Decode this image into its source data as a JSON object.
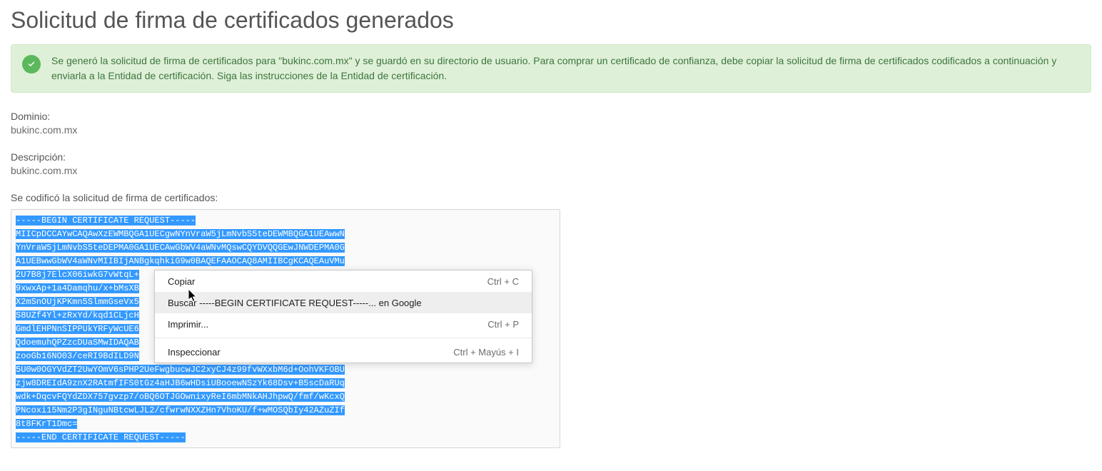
{
  "page": {
    "title": "Solicitud de firma de certificados generados"
  },
  "alert": {
    "message": "Se generó la solicitud de firma de certificados para \"bukinc.com.mx\" y se guardó en su directorio de usuario. Para comprar un certificado de confianza, debe copiar la solicitud de firma de certificados codificados a continuación y enviarla a la Entidad de certificación. Siga las instrucciones de la Entidad de certificación."
  },
  "fields": {
    "domain_label": "Dominio:",
    "domain_value": "bukinc.com.mx",
    "description_label": "Descripción:",
    "description_value": "bukinc.com.mx",
    "csr_label": "Se codificó la solicitud de firma de certificados:"
  },
  "csr": "-----BEGIN CERTIFICATE REQUEST-----\nMIICpDCCAYwCAQAwXzEWMBQGA1UECgwNYnVraW5jLmNvbS5teDEWMBQGA1UEAwwN\nYnVraW5jLmNvbS5teDEPMA0GA1UECAwGbWV4aWNvMQswCQYDVQQGEwJNWDEPMA0G\nA1UEBwwGbWV4aWNvMIIBIjANBgkqhkiG9w0BAQEFAAOCAQ8AMIIBCgKCAQEAuVMu\n2U7B8j7ElcX06iwkG7vWtqL+\n9xwxAp+1a4Damqhu/x+bMsXB\nX2mSnOUjKPKmn5SlmmGseVx5\nS8UZf4Yl+zRxYd/kqd1CLjcH\nGmdlEHPNnSIPPUkYRFyWcUE6\nQdoemuhQPZzcDUaSMwIDAQAB\nzooGb16NO03/ceRI9BdILD9N\n5U0w0OGYVdZT2UwYOmV6sPHP2UeFwgbucwJC2xyCJ4z99fvWXxbM6d+OohVKFOBU\nzjw8DREIdA9znX2RAtmfIFS0tGz4aHJB6wHDsiUBooewNSzYk68Dsv+B5scDaRUq\nwdk+DqcvFQYdZDX757gvzp7/oBQ6OTJGOwnixyReI6mbMNkAHJhpwQ/fmf/wKcxQ\nPNcoxi15Nm2P3gINguNBtcwLJL2/cfwrwNXXZHn7VhoKU/f+wMOSQbIy42AZuZIf\n8t8FKrT1Dmc=\n-----END CERTIFICATE REQUEST-----",
  "context_menu": {
    "items": [
      {
        "label": "Copiar",
        "shortcut": "Ctrl + C",
        "hover": false
      },
      {
        "label": "Buscar -----BEGIN CERTIFICATE REQUEST-----... en Google",
        "shortcut": "",
        "hover": true
      },
      {
        "label": "Imprimir...",
        "shortcut": "Ctrl + P",
        "hover": false
      }
    ],
    "inspect": {
      "label": "Inspeccionar",
      "shortcut": "Ctrl + Mayús + I"
    }
  }
}
